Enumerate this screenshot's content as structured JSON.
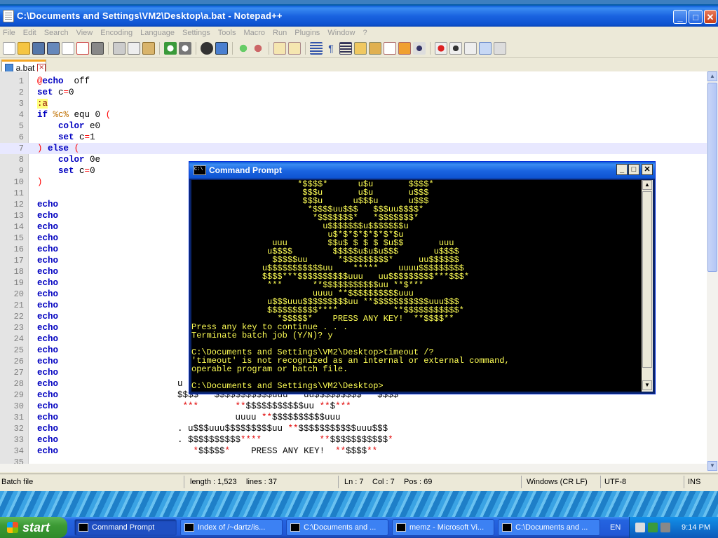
{
  "notepad": {
    "title": "C:\\Documents and Settings\\VM2\\Desktop\\a.bat - Notepad++",
    "menu": [
      "File",
      "Edit",
      "Search",
      "View",
      "Encoding",
      "Language",
      "Settings",
      "Tools",
      "Macro",
      "Run",
      "Plugins",
      "Window",
      "?"
    ],
    "tab_label": "a.bat",
    "lines": [
      {
        "n": "1",
        "parts": [
          [
            "at",
            "@"
          ],
          [
            "kw",
            "echo"
          ],
          [
            "",
            "  off"
          ]
        ]
      },
      {
        "n": "2",
        "parts": [
          [
            "kw",
            "set"
          ],
          [
            "",
            " c"
          ],
          [
            "op",
            "="
          ],
          [
            "",
            "0"
          ]
        ]
      },
      {
        "n": "3",
        "parts": [
          [
            "lbl",
            ":a"
          ]
        ]
      },
      {
        "n": "4",
        "parts": [
          [
            "kw",
            "if"
          ],
          [
            "",
            " "
          ],
          [
            "var",
            "%c%"
          ],
          [
            "",
            " equ 0 "
          ],
          [
            "op",
            "("
          ]
        ]
      },
      {
        "n": "5",
        "parts": [
          [
            "",
            "    "
          ],
          [
            "kw",
            "color"
          ],
          [
            "",
            " e0"
          ]
        ]
      },
      {
        "n": "6",
        "parts": [
          [
            "",
            "    "
          ],
          [
            "kw",
            "set"
          ],
          [
            "",
            " c"
          ],
          [
            "op",
            "="
          ],
          [
            "",
            "1"
          ]
        ]
      },
      {
        "n": "7",
        "parts": [
          [
            "op",
            ")"
          ],
          [
            "",
            " "
          ],
          [
            "kw",
            "else"
          ],
          [
            "",
            " "
          ],
          [
            "op",
            "("
          ]
        ]
      },
      {
        "n": "8",
        "parts": [
          [
            "",
            "    "
          ],
          [
            "kw",
            "color"
          ],
          [
            "",
            " 0e"
          ]
        ]
      },
      {
        "n": "9",
        "parts": [
          [
            "",
            "    "
          ],
          [
            "kw",
            "set"
          ],
          [
            "",
            " c"
          ],
          [
            "op",
            "="
          ],
          [
            "",
            "0"
          ]
        ]
      },
      {
        "n": "10",
        "parts": [
          [
            "op",
            ")"
          ]
        ]
      },
      {
        "n": "11",
        "parts": []
      },
      {
        "n": "12",
        "parts": [
          [
            "kw",
            "echo"
          ]
        ]
      },
      {
        "n": "13",
        "parts": [
          [
            "kw",
            "echo"
          ]
        ]
      },
      {
        "n": "14",
        "parts": [
          [
            "kw",
            "echo"
          ]
        ]
      },
      {
        "n": "15",
        "parts": [
          [
            "kw",
            "echo"
          ]
        ]
      },
      {
        "n": "16",
        "parts": [
          [
            "kw",
            "echo"
          ]
        ]
      },
      {
        "n": "17",
        "parts": [
          [
            "kw",
            "echo"
          ]
        ]
      },
      {
        "n": "18",
        "parts": [
          [
            "kw",
            "echo"
          ]
        ]
      },
      {
        "n": "19",
        "parts": [
          [
            "kw",
            "echo"
          ]
        ]
      },
      {
        "n": "20",
        "parts": [
          [
            "kw",
            "echo"
          ]
        ]
      },
      {
        "n": "21",
        "parts": [
          [
            "kw",
            "echo"
          ]
        ]
      },
      {
        "n": "22",
        "parts": [
          [
            "kw",
            "echo"
          ]
        ]
      },
      {
        "n": "23",
        "parts": [
          [
            "kw",
            "echo"
          ]
        ]
      },
      {
        "n": "24",
        "parts": [
          [
            "kw",
            "echo"
          ]
        ]
      },
      {
        "n": "25",
        "parts": [
          [
            "kw",
            "echo"
          ]
        ]
      },
      {
        "n": "26",
        "parts": [
          [
            "kw",
            "echo"
          ]
        ]
      },
      {
        "n": "27",
        "parts": [
          [
            "kw",
            "echo"
          ]
        ]
      },
      {
        "n": "28",
        "parts": [
          [
            "kw",
            "echo"
          ]
        ],
        "art": [
          [
            "",
            "u"
          ]
        ]
      },
      {
        "n": "29",
        "parts": [
          [
            "kw",
            "echo"
          ]
        ],
        "art": [
          [
            "",
            "$$$$"
          ],
          [
            "red",
            "***"
          ],
          [
            "",
            "$$$$$$$$$$$uuu   uu$$$$$$$$$"
          ],
          [
            "red",
            "***"
          ],
          [
            "",
            "$$$$"
          ]
        ]
      },
      {
        "n": "30",
        "parts": [
          [
            "kw",
            "echo"
          ]
        ],
        "art": [
          [
            "red",
            " ***"
          ],
          [
            "",
            "       "
          ],
          [
            "red",
            "**"
          ],
          [
            "",
            "$$$$$$$$$$$uu "
          ],
          [
            "red",
            "**"
          ],
          [
            "",
            "$"
          ],
          [
            "red",
            "***"
          ]
        ]
      },
      {
        "n": "31",
        "parts": [
          [
            "kw",
            "echo"
          ]
        ],
        "art": [
          [
            "",
            "           uuuu "
          ],
          [
            "red",
            "**"
          ],
          [
            "",
            "$$$$$$$$$$uuu"
          ]
        ]
      },
      {
        "n": "32",
        "parts": [
          [
            "kw",
            "echo"
          ]
        ],
        "art": [
          [
            "",
            ". u$$$uuu$$$$$$$$$uu "
          ],
          [
            "red",
            "**"
          ],
          [
            "",
            "$$$$$$$$$$$uuu$$$"
          ]
        ]
      },
      {
        "n": "33",
        "parts": [
          [
            "kw",
            "echo"
          ]
        ],
        "art": [
          [
            "",
            ". $$$$$$$$$$"
          ],
          [
            "red",
            "****"
          ],
          [
            "",
            "           "
          ],
          [
            "red",
            "**"
          ],
          [
            "",
            "$$$$$$$$$$$"
          ],
          [
            "red",
            "*"
          ]
        ]
      },
      {
        "n": "34",
        "parts": [
          [
            "kw",
            "echo"
          ]
        ],
        "art": [
          [
            "",
            "   "
          ],
          [
            "red",
            "*"
          ],
          [
            "",
            "$$$$$"
          ],
          [
            "red",
            "*"
          ],
          [
            "",
            "    PRESS ANY KEY!  "
          ],
          [
            "red",
            "**"
          ],
          [
            "",
            "$$$$"
          ],
          [
            "red",
            "**"
          ]
        ]
      },
      {
        "n": "35",
        "parts": []
      }
    ],
    "status": {
      "type": "Batch file",
      "length": "length : 1,523",
      "lines": "lines : 37",
      "ln": "Ln : 7",
      "col": "Col : 7",
      "pos": "Pos : 69",
      "eol": "Windows (CR LF)",
      "enc": "UTF-8",
      "ins": "INS"
    }
  },
  "cmd": {
    "title": "Command Prompt",
    "icon_text": "C:\\",
    "lines": [
      "                     *$$$$*      u$u       $$$$*",
      "                      $$$u       u$u       u$$$",
      "                      $$$u      u$$$u      u$$$",
      "                       *$$$$uu$$$   $$$uu$$$$*",
      "                        *$$$$$$$*   *$$$$$$$*",
      "                          u$$$$$$$u$$$$$$$u",
      "                           u$*$*$*$*$*$*$u",
      "                uuu        $$u$ $ $ $ $u$$       uuu",
      "               u$$$$        $$$$$u$u$u$$$       u$$$$",
      "                $$$$$uu      *$$$$$$$$$*     uu$$$$$$",
      "              u$$$$$$$$$$$uu    *****    uuuu$$$$$$$$$",
      "              $$$$***$$$$$$$$$$uuu   uu$$$$$$$$$***$$$*",
      "               ***      **$$$$$$$$$$$uu **$***",
      "                        uuuu **$$$$$$$$$$uuu",
      "               u$$$uuu$$$$$$$$$uu **$$$$$$$$$$$uuu$$$",
      "               $$$$$$$$$$****           **$$$$$$$$$$$*",
      "                 *$$$$$*    PRESS ANY KEY!  **$$$$**",
      "Press any key to continue . . .",
      "Terminate batch job (Y/N)? y",
      "",
      "C:\\Documents and Settings\\VM2\\Desktop>timeout /?",
      "'timeout' is not recognized as an internal or external command,",
      "operable program or batch file.",
      "",
      "C:\\Documents and Settings\\VM2\\Desktop>"
    ]
  },
  "taskbar": {
    "start": "start",
    "buttons": [
      {
        "label": "Command Prompt",
        "active": true
      },
      {
        "label": "Index of /~dartz/is...",
        "active": false
      },
      {
        "label": "C:\\Documents and ...",
        "active": false
      },
      {
        "label": "memz - Microsoft Vi...",
        "active": false
      },
      {
        "label": "C:\\Documents and ...",
        "active": false
      }
    ],
    "lang": "EN",
    "clock": "9:14 PM"
  }
}
